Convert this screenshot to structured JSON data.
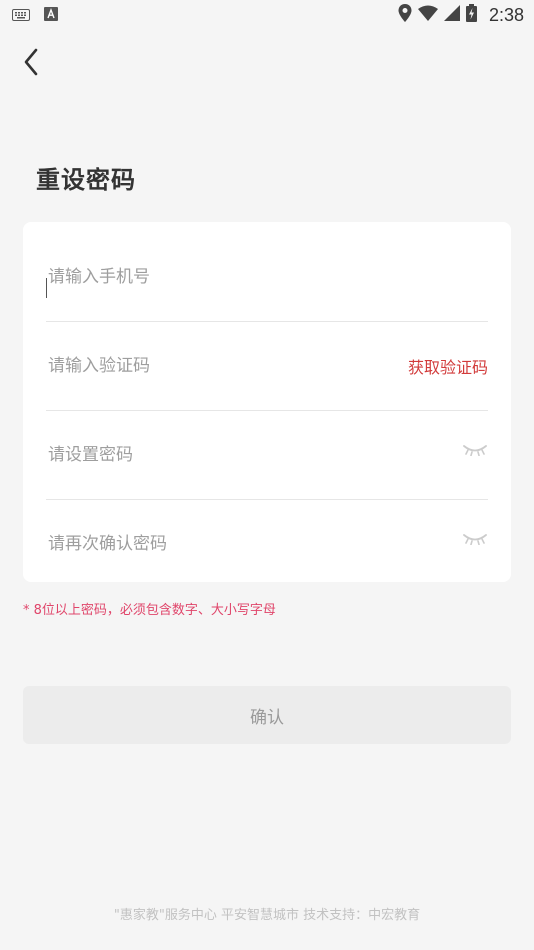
{
  "status_bar": {
    "time": "2:38",
    "icons": [
      "keyboard-icon",
      "font-icon",
      "location-icon",
      "wifi-icon",
      "signal-icon",
      "battery-charging-icon"
    ]
  },
  "page": {
    "title": "重设密码"
  },
  "form": {
    "phone_placeholder": "请输入手机号",
    "code_placeholder": "请输入验证码",
    "get_code_label": "获取验证码",
    "password_placeholder": "请设置密码",
    "confirm_password_placeholder": "请再次确认密码"
  },
  "hint": "* 8位以上密码，必须包含数字、大小写字母",
  "confirm_button_label": "确认",
  "footer": "\"惠家教\"服务中心 平安智慧城市 技术支持：中宏教育",
  "colors": {
    "accent_red": "#d23b3b",
    "hint_pink": "#e0456a",
    "background": "#f5f5f5",
    "card": "#ffffff",
    "button_disabled": "#ececec"
  }
}
